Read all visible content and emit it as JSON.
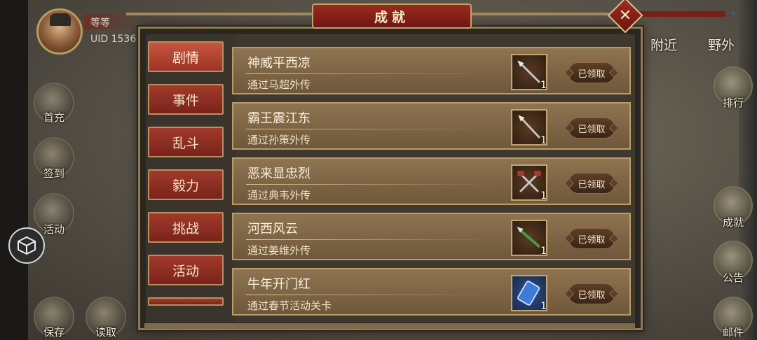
{
  "player": {
    "name": "等等",
    "uid": "UID  1536"
  },
  "top_tabs": [
    "附近",
    "野外"
  ],
  "left_menu": [
    {
      "label": "首充",
      "icon": "bag-icon"
    },
    {
      "label": "签到",
      "icon": "scroll-icon"
    },
    {
      "label": "活动",
      "icon": "gift-icon"
    },
    {
      "label": "保存",
      "icon": "save-icon"
    },
    {
      "label": "读取",
      "icon": "load-icon"
    }
  ],
  "right_menu": [
    {
      "label": "排行",
      "icon": "banner-icon"
    },
    {
      "label": "成就",
      "icon": "city-icon"
    },
    {
      "label": "公告",
      "icon": "notice-icon"
    },
    {
      "label": "邮件",
      "icon": "mail-icon"
    }
  ],
  "panel": {
    "title": "成就",
    "close_label": "✕"
  },
  "categories": [
    {
      "label": "剧情",
      "active": true
    },
    {
      "label": "事件",
      "active": false
    },
    {
      "label": "乱斗",
      "active": false
    },
    {
      "label": "毅力",
      "active": false
    },
    {
      "label": "挑战",
      "active": false
    },
    {
      "label": "活动",
      "active": false
    }
  ],
  "achievements": [
    {
      "title": "神威平西凉",
      "desc": "通过马超外传",
      "item_icon": "spear-icon",
      "count": "1",
      "status": "已领取"
    },
    {
      "title": "霸王震江东",
      "desc": "通过孙策外传",
      "item_icon": "spear-icon",
      "count": "1",
      "status": "已领取"
    },
    {
      "title": "恶来显忠烈",
      "desc": "通过典韦外传",
      "item_icon": "crossed-axes-icon",
      "count": "1",
      "status": "已领取"
    },
    {
      "title": "河西风云",
      "desc": "通过姜维外传",
      "item_icon": "green-spear-icon",
      "count": "1",
      "status": "已领取"
    },
    {
      "title": "牛年开门红",
      "desc": "通过春节活动关卡",
      "item_icon": "blue-card-icon",
      "count": "1",
      "status": "已领取"
    }
  ],
  "colors": {
    "accent_red": "#9b3325",
    "gold_border": "#c2a467",
    "row_brown": "#8e7450"
  }
}
